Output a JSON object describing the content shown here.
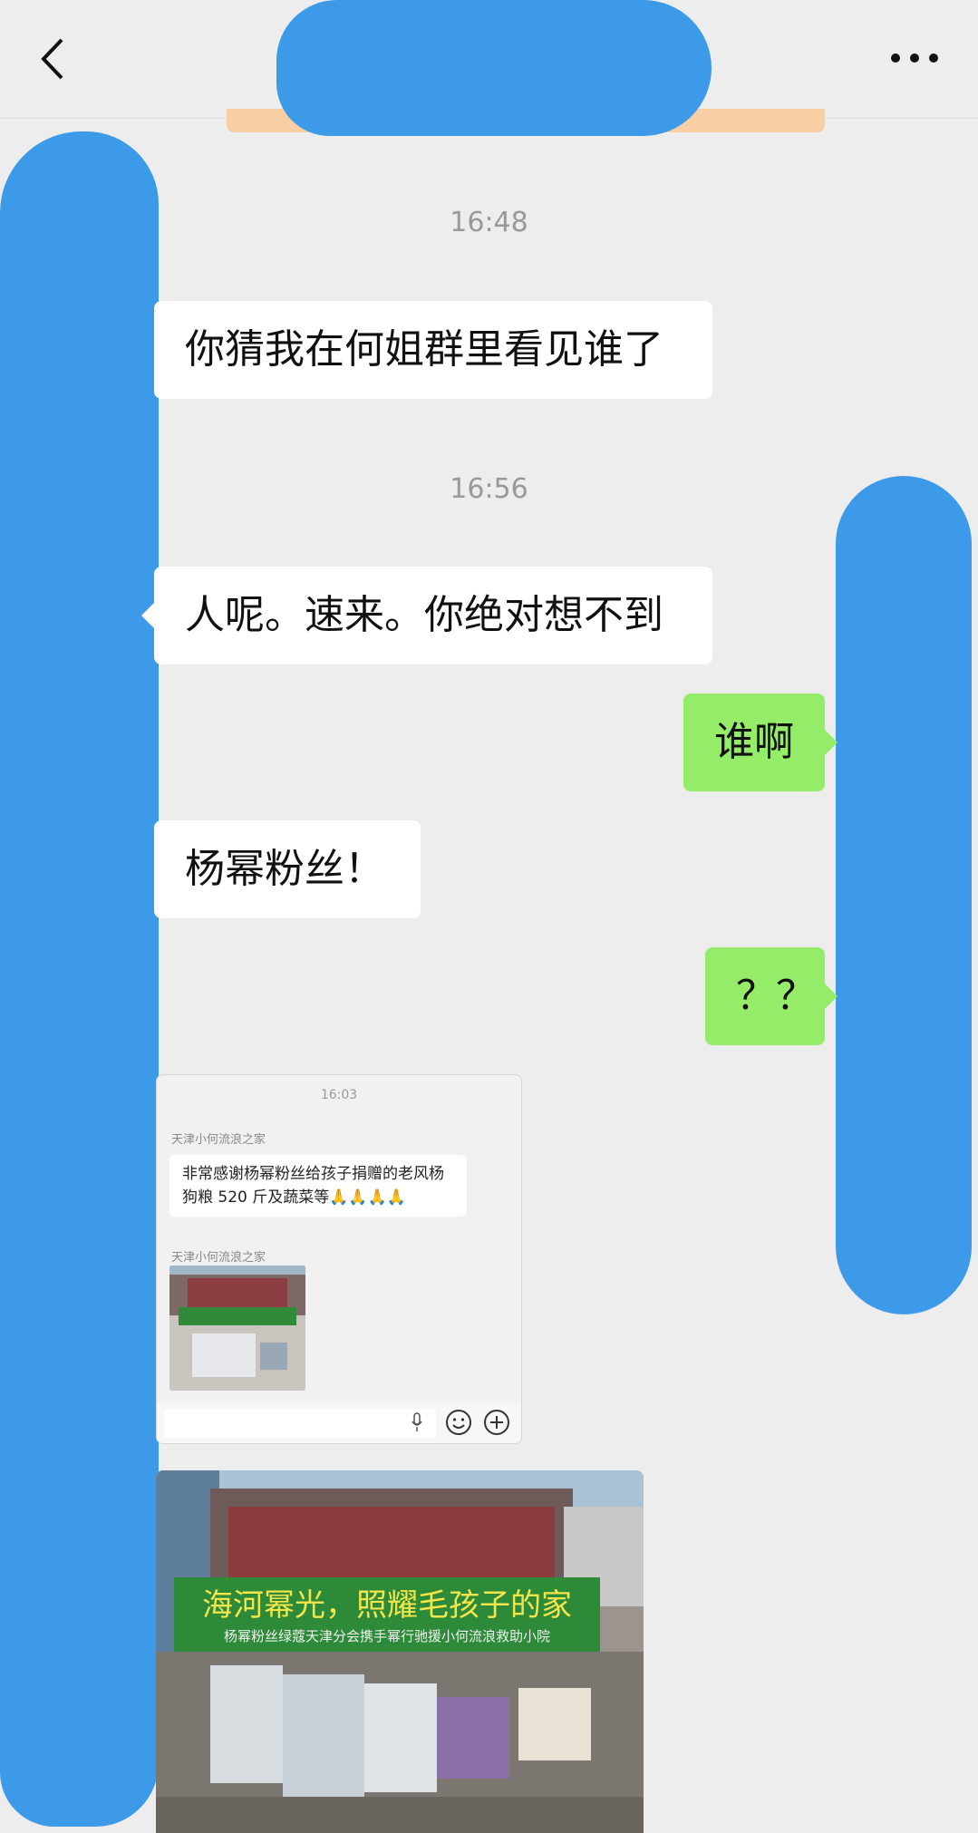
{
  "header": {
    "back": "back",
    "more": "more"
  },
  "messages": [
    {
      "time": "16:48"
    },
    {
      "side": "left",
      "text": "你猜我在何姐群里看见谁了"
    },
    {
      "time": "16:56"
    },
    {
      "side": "left",
      "text": "人呢。速来。你绝对想不到"
    },
    {
      "side": "right",
      "text": "谁啊"
    },
    {
      "side": "left",
      "text": "杨幂粉丝！"
    },
    {
      "side": "right",
      "text": "？？"
    }
  ],
  "nested_screenshot": {
    "time": "16:03",
    "sender1": "天津小何流浪之家",
    "message": "非常感谢杨幂粉丝给孩子捐赠的老风杨狗粮 520 斤及蔬菜等🙏🙏🙏🙏",
    "sender2": "天津小何流浪之家"
  },
  "photo": {
    "banner_main": "海河幂光，照耀毛孩子的家",
    "banner_sub": "杨幂粉丝绿蔻天津分会携手幂行驰援小何流浪救助小院"
  },
  "colors": {
    "left_bubble": "#ffffff",
    "right_bubble": "#95ec69",
    "redact": "#3d9ae8",
    "background": "#ededed"
  }
}
